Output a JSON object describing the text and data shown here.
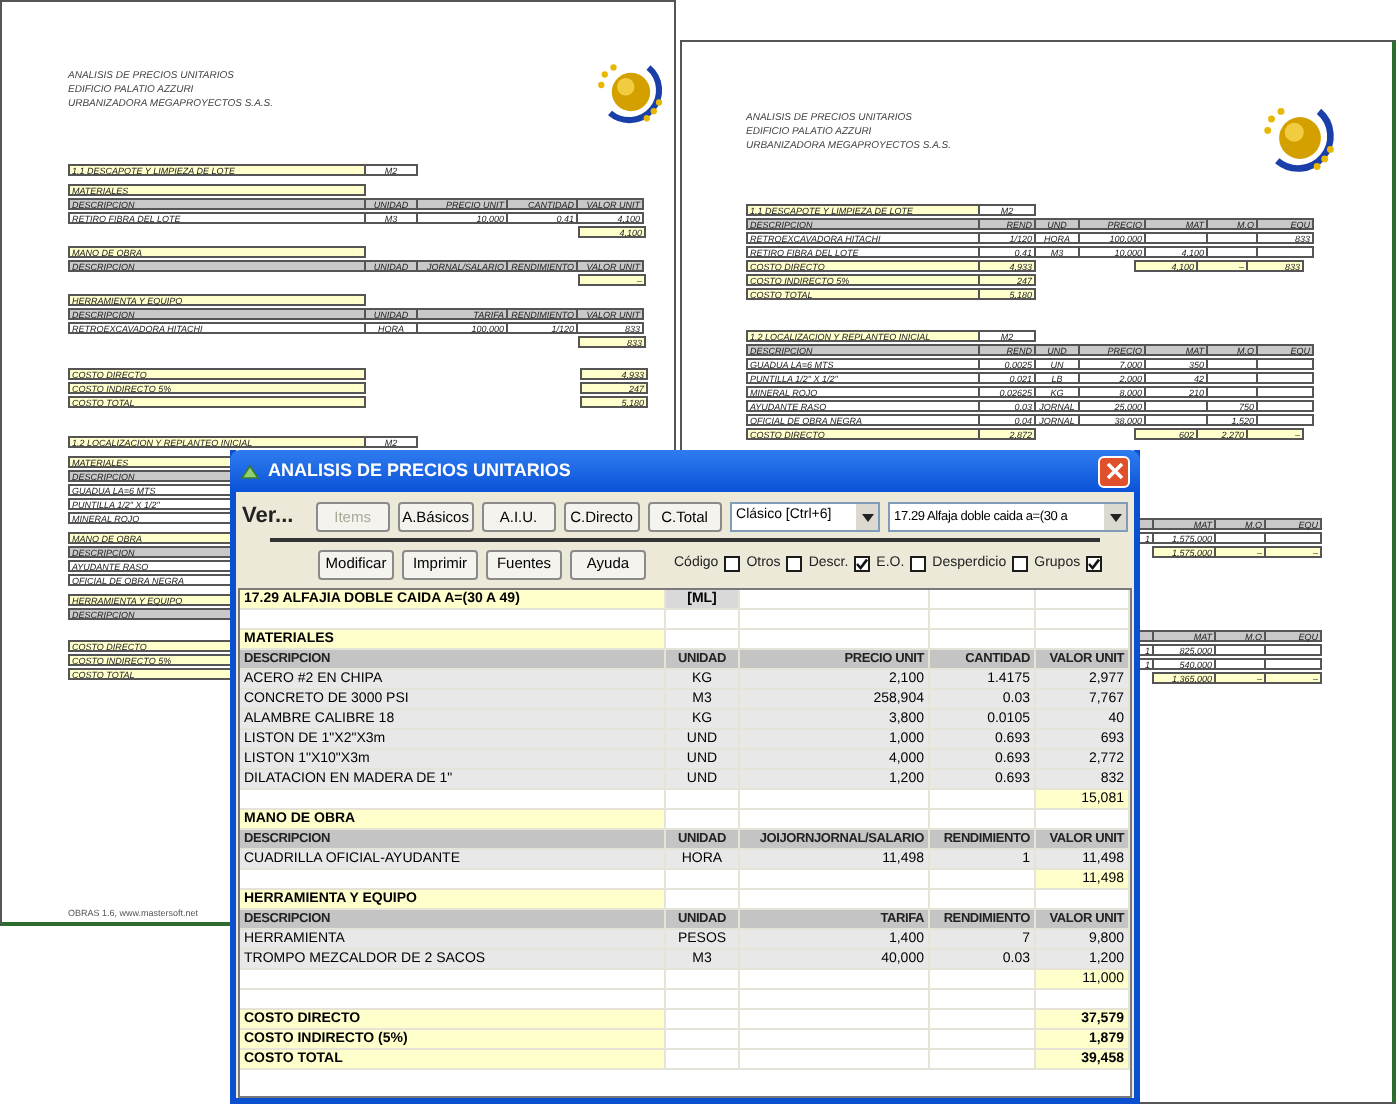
{
  "left_page": {
    "heading": [
      "ANALISIS DE PRECIOS UNITARIOS",
      "EDIFICIO PALATIO AZZURI",
      "URBANIZADORA MEGAPROYECTOS S.A.S."
    ],
    "sections": [
      {
        "title": "1.1 DESCAPOTE Y LIMPIEZA DE LOTE",
        "unit": "M2",
        "groups": [
          {
            "title": "MATERIALES",
            "columns": [
              "DESCRIPCION",
              "UNIDAD",
              "PRECIO UNIT",
              "CANTIDAD",
              "VALOR UNIT"
            ],
            "rows": [
              [
                "RETIRO FIBRA DEL LOTE",
                "M3",
                "10,000",
                "0.41",
                "4,100"
              ]
            ],
            "subtotal": "4,100"
          },
          {
            "title": "MANO DE OBRA",
            "columns": [
              "DESCRIPCION",
              "UNIDAD",
              "JORNAL/SALARIO",
              "RENDIMIENTO",
              "VALOR UNIT"
            ],
            "subtotal": "–"
          },
          {
            "title": "HERRAMIENTA Y EQUIPO",
            "columns": [
              "DESCRIPCION",
              "UNIDAD",
              "TARIFA",
              "RENDIMIENTO",
              "VALOR UNIT"
            ],
            "rows": [
              [
                "RETROEXCAVADORA HITACHI",
                "HORA",
                "100,000",
                "1/120",
                "833"
              ]
            ],
            "subtotal": "833"
          }
        ],
        "totals": [
          {
            "label": "COSTO DIRECTO",
            "value": "4,933"
          },
          {
            "label": "COSTO INDIRECTO 5%",
            "value": "247"
          },
          {
            "label": "COSTO TOTAL",
            "value": "5,180"
          }
        ]
      },
      {
        "title": "1.2 LOCALIZACION Y REPLANTEO INICIAL",
        "unit": "M2",
        "groups": [
          {
            "title": "MATERIALES",
            "columns": [
              "DESCRIPCION"
            ],
            "rows": [
              [
                "GUADUA LA=6 MTS"
              ],
              [
                "PUNTILLA 1/2\" X 1/2\""
              ],
              [
                "MINERAL ROJO"
              ]
            ]
          },
          {
            "title": "MANO DE OBRA",
            "columns": [
              "DESCRIPCION"
            ],
            "rows": [
              [
                "AYUDANTE RASO"
              ],
              [
                "OFICIAL DE OBRA NEGRA"
              ]
            ]
          },
          {
            "title": "HERRAMIENTA Y EQUIPO",
            "columns": [
              "DESCRIPCION"
            ]
          }
        ],
        "totals": [
          {
            "label": "COSTO DIRECTO"
          },
          {
            "label": "COSTO INDIRECTO 5%"
          },
          {
            "label": "COSTO TOTAL"
          }
        ]
      }
    ],
    "footer": "OBRAS 1.6, www.mastersoft.net"
  },
  "right_page": {
    "heading": [
      "ANALISIS DE PRECIOS UNITARIOS",
      "EDIFICIO PALATIO AZZURI",
      "URBANIZADORA MEGAPROYECTOS S.A.S."
    ],
    "sections": [
      {
        "title": "1.1 DESCAPOTE Y LIMPIEZA DE LOTE",
        "unit": "M2",
        "columns": [
          "DESCRIPCION",
          "REND",
          "UND",
          "PRECIO",
          "MAT",
          "M.O",
          "EQU"
        ],
        "rows": [
          {
            "desc": "RETROEXCAVADORA HITACHI",
            "rend": "1/120",
            "und": "HORA",
            "precio": "100,000",
            "equ": "833"
          },
          {
            "desc": "RETIRO FIBRA DEL LOTE",
            "rend": "0.41",
            "und": "M3",
            "precio": "10,000",
            "mat": "4,100"
          }
        ],
        "totals": [
          {
            "label": "COSTO DIRECTO",
            "value": "4,933",
            "mat": "4,100",
            "mo": "–",
            "equ": "833"
          },
          {
            "label": "COSTO INDIRECTO 5%",
            "value": "247"
          },
          {
            "label": "COSTO TOTAL",
            "value": "5,180"
          }
        ]
      },
      {
        "title": "1.2 LOCALIZACION Y REPLANTEO INICIAL",
        "unit": "M2",
        "columns": [
          "DESCRIPCION",
          "REND",
          "UND",
          "PRECIO",
          "MAT",
          "M.O",
          "EQU"
        ],
        "rows": [
          {
            "desc": "GUADUA LA=6 MTS",
            "rend": "0.0025",
            "und": "UN",
            "precio": "7,000",
            "mat": "350"
          },
          {
            "desc": "PUNTILLA 1/2\" X 1/2\"",
            "rend": "0.021",
            "und": "LB",
            "precio": "2,000",
            "mat": "42"
          },
          {
            "desc": "MINERAL ROJO",
            "rend": "0.02625",
            "und": "KG",
            "precio": "8,000",
            "mat": "210"
          },
          {
            "desc": "AYUDANTE RASO",
            "rend": "0.03",
            "und": "JORNAL",
            "precio": "25,000",
            "mo": "750"
          },
          {
            "desc": "OFICIAL DE OBRA NEGRA",
            "rend": "0.04",
            "und": "JORNAL",
            "precio": "38,000",
            "mo": "1,520"
          }
        ],
        "totals": [
          {
            "label": "COSTO DIRECTO",
            "value": "2,872",
            "mat": "602",
            "mo": "2,270",
            "equ": "–"
          }
        ]
      }
    ],
    "partial_tables": [
      {
        "columns": [
          "MAT",
          "M.O",
          "EQU"
        ],
        "rows": [
          {
            "cut": "1",
            "mat": "1,575,000"
          }
        ],
        "subtotal": {
          "mat": "1,575,000",
          "mo": "–",
          "equ": "–"
        }
      },
      {
        "columns": [
          "MAT",
          "M.O",
          "EQU"
        ],
        "rows": [
          {
            "cut": "1",
            "mat": "825,000"
          },
          {
            "cut": "1",
            "mat": "540,000"
          }
        ],
        "subtotal": {
          "mat": "1,365,000",
          "mo": "–",
          "equ": "–"
        }
      }
    ]
  },
  "dialog": {
    "title": "ANALISIS DE PRECIOS UNITARIOS",
    "view_label": "Ver...",
    "view_buttons": [
      {
        "label": "Items",
        "disabled": true
      },
      {
        "label": "A.Básicos",
        "disabled": false
      },
      {
        "label": "A.I.U.",
        "disabled": false
      },
      {
        "label": "C.Directo",
        "disabled": false
      },
      {
        "label": "C.Total",
        "disabled": false
      }
    ],
    "style_select": "Clásico [Ctrl+6]",
    "item_select": "17.29 Alfaja doble caida  a=(30 a",
    "action_buttons": [
      "Modificar",
      "Imprimir",
      "Fuentes",
      "Ayuda"
    ],
    "options": [
      {
        "label": "Código",
        "checked": false
      },
      {
        "label": "Otros",
        "checked": false
      },
      {
        "label": "Descr.",
        "checked": true
      },
      {
        "label": "E.O.",
        "checked": false
      },
      {
        "label": "Desperdicio",
        "checked": false
      },
      {
        "label": "Grupos",
        "checked": true
      }
    ],
    "grid": {
      "rows": [
        {
          "kind": "title",
          "cells": [
            "17.29 ALFAJIA DOBLE CAIDA  A=(30 A 49)",
            "[ML]"
          ]
        },
        {
          "kind": "blank"
        },
        {
          "kind": "group",
          "cells": [
            "MATERIALES"
          ]
        },
        {
          "kind": "header",
          "cells": [
            "DESCRIPCION",
            "UNIDAD",
            "PRECIO UNIT",
            "CANTIDAD",
            "VALOR UNIT"
          ]
        },
        {
          "kind": "item",
          "cells": [
            "ACERO #2 EN CHIPA",
            "KG",
            "2,100",
            "1.4175",
            "2,977"
          ]
        },
        {
          "kind": "item",
          "cells": [
            "CONCRETO DE 3000 PSI",
            "M3",
            "258,904",
            "0.03",
            "7,767"
          ]
        },
        {
          "kind": "item",
          "cells": [
            "ALAMBRE CALIBRE 18",
            "KG",
            "3,800",
            "0.0105",
            "40"
          ]
        },
        {
          "kind": "item",
          "cells": [
            "LISTON DE 1\"X2\"X3m",
            "UND",
            "1,000",
            "0.693",
            "693"
          ]
        },
        {
          "kind": "item",
          "cells": [
            "LISTON 1\"X10\"X3m",
            "UND",
            "4,000",
            "0.693",
            "2,772"
          ]
        },
        {
          "kind": "item",
          "cells": [
            "DILATACION EN MADERA DE 1\"",
            "UND",
            "1,200",
            "0.693",
            "832"
          ]
        },
        {
          "kind": "subtotal",
          "cells": [
            "15,081"
          ]
        },
        {
          "kind": "group",
          "cells": [
            "MANO DE OBRA"
          ]
        },
        {
          "kind": "header",
          "cells": [
            "DESCRIPCION",
            "UNIDAD",
            "JOIJORNJORNAL/SALARIO",
            "RENDIMIENTO",
            "VALOR UNIT"
          ]
        },
        {
          "kind": "item",
          "cells": [
            "CUADRILLA OFICIAL-AYUDANTE",
            "HORA",
            "11,498",
            "1",
            "11,498"
          ]
        },
        {
          "kind": "subtotal",
          "cells": [
            "11,498"
          ]
        },
        {
          "kind": "group",
          "cells": [
            "HERRAMIENTA Y EQUIPO"
          ]
        },
        {
          "kind": "header",
          "cells": [
            "DESCRIPCION",
            "UNIDAD",
            "TARIFA",
            "RENDIMIENTO",
            "VALOR UNIT"
          ]
        },
        {
          "kind": "item",
          "cells": [
            "HERRAMIENTA",
            "PESOS",
            "1,400",
            "7",
            "9,800"
          ]
        },
        {
          "kind": "item",
          "cells": [
            "TROMPO MEZCALDOR DE 2 SACOS",
            "M3",
            "40,000",
            "0.03",
            "1,200"
          ]
        },
        {
          "kind": "subtotal",
          "cells": [
            "11,000"
          ]
        },
        {
          "kind": "blank"
        },
        {
          "kind": "total",
          "cells": [
            "COSTO DIRECTO",
            "37,579"
          ]
        },
        {
          "kind": "total",
          "cells": [
            "COSTO INDIRECTO (5%)",
            "1,879"
          ]
        },
        {
          "kind": "total",
          "cells": [
            "COSTO TOTAL",
            "39,458"
          ]
        }
      ]
    }
  }
}
